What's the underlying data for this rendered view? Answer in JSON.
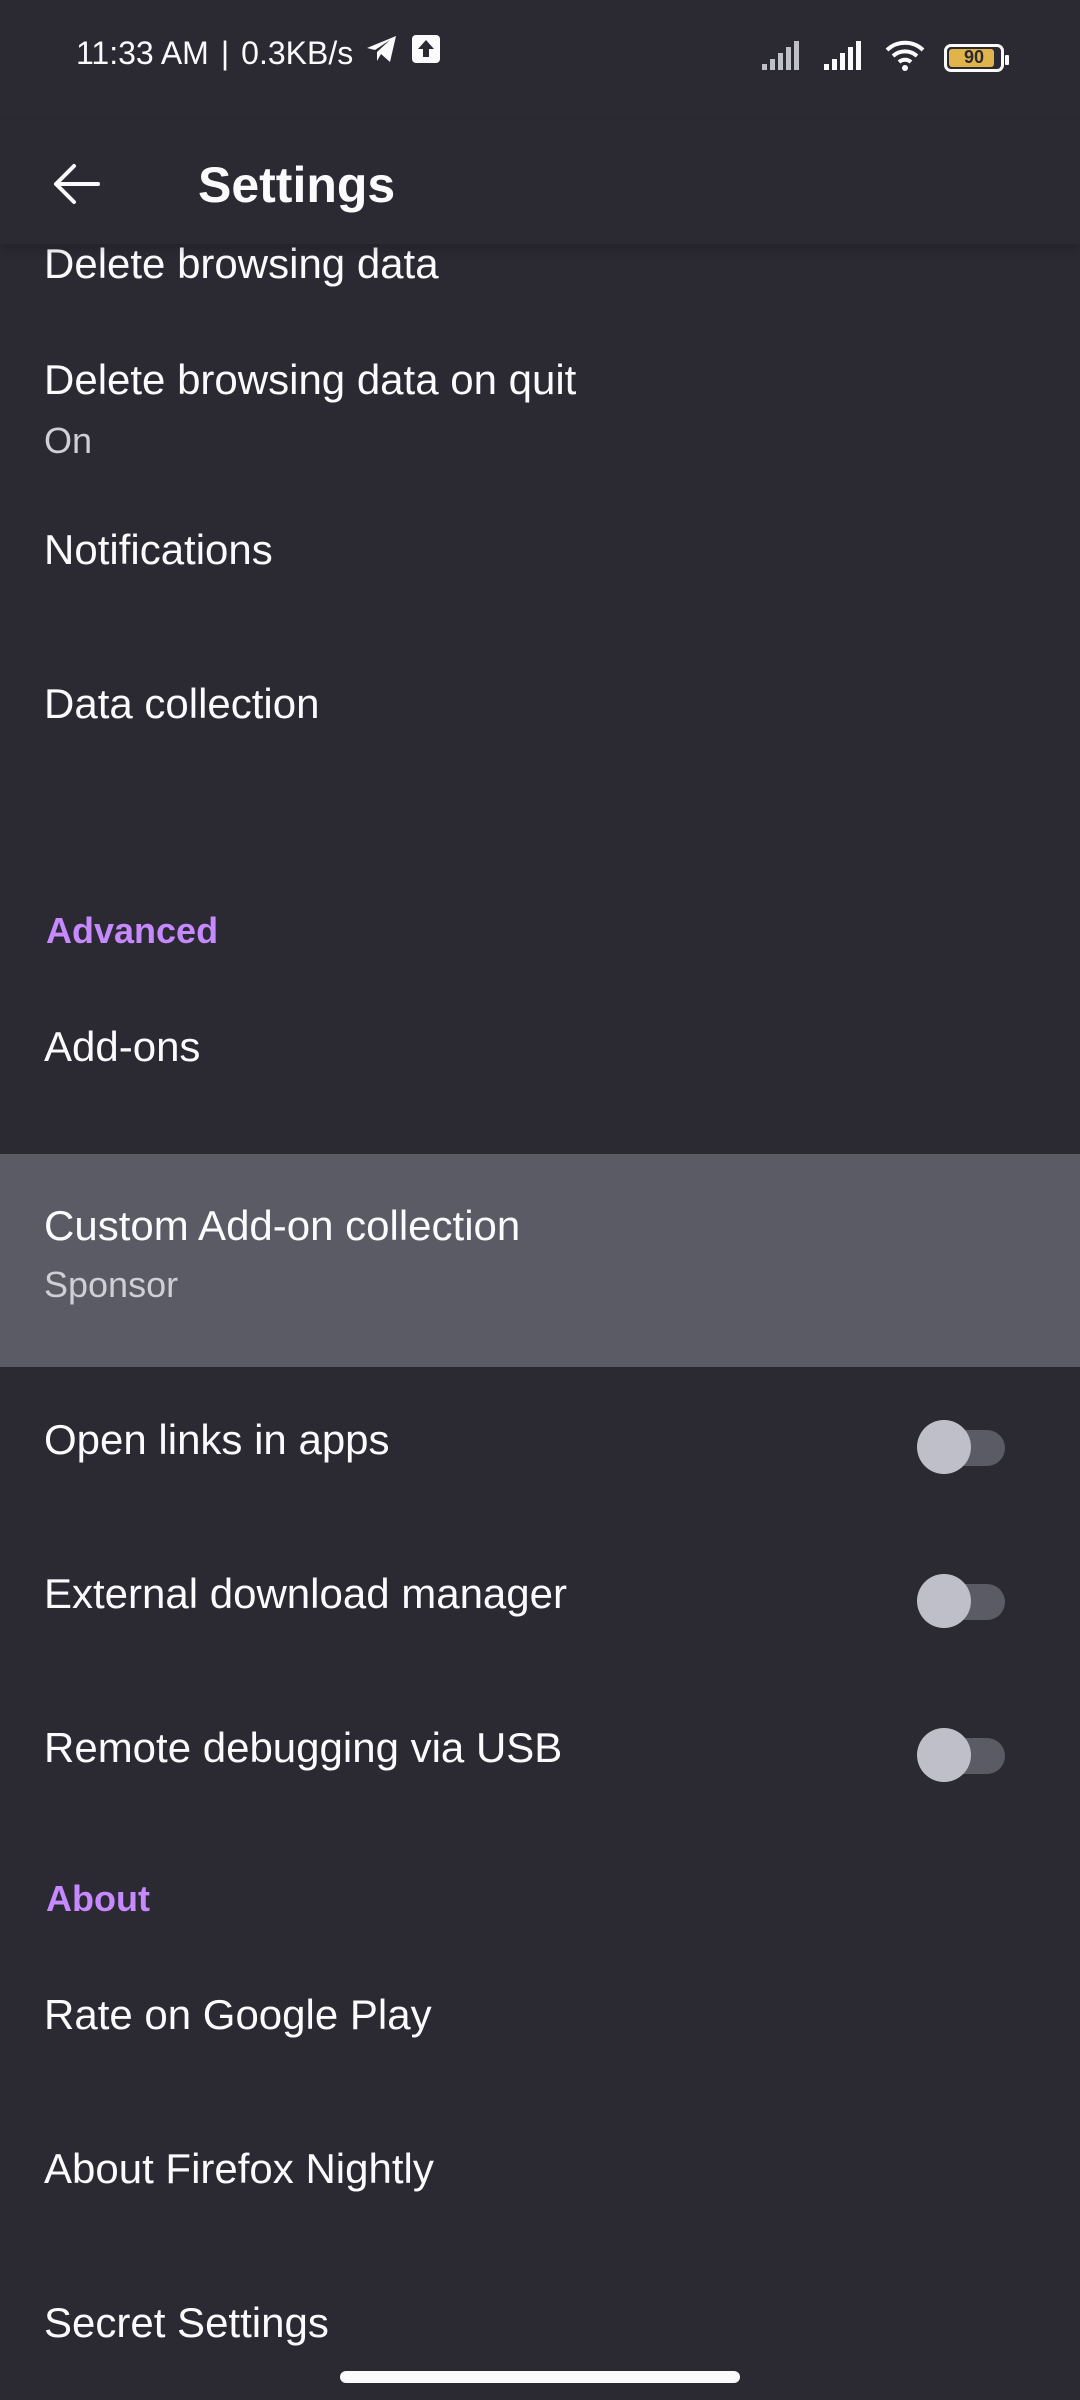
{
  "status_bar": {
    "time": "11:33 AM",
    "separator": "|",
    "net_speed": "0.3KB/s",
    "battery": "90",
    "battery_level": 0.9
  },
  "app_bar": {
    "title": "Settings",
    "back_icon": "arrow-back-icon"
  },
  "items": [
    {
      "title": "Delete browsing data"
    },
    {
      "title": "Delete browsing data on quit",
      "summary": "On"
    },
    {
      "title": "Notifications"
    },
    {
      "title": "Data collection"
    }
  ],
  "advanced": {
    "header": "Advanced",
    "items": [
      {
        "title": "Add-ons"
      },
      {
        "title": "Custom Add-on collection",
        "summary": "Sponsor"
      },
      {
        "title": "Open links in apps",
        "toggle": false
      },
      {
        "title": "External download manager",
        "toggle": false
      },
      {
        "title": "Remote debugging via USB",
        "toggle": false
      }
    ]
  },
  "about": {
    "header": "About",
    "items": [
      {
        "title": "Rate on Google Play"
      },
      {
        "title": "About Firefox Nightly"
      },
      {
        "title": "Secret Settings"
      }
    ]
  },
  "colors": {
    "background": "#2b2a33",
    "accent": "#c689ff",
    "pressed": "#5b5b66"
  }
}
